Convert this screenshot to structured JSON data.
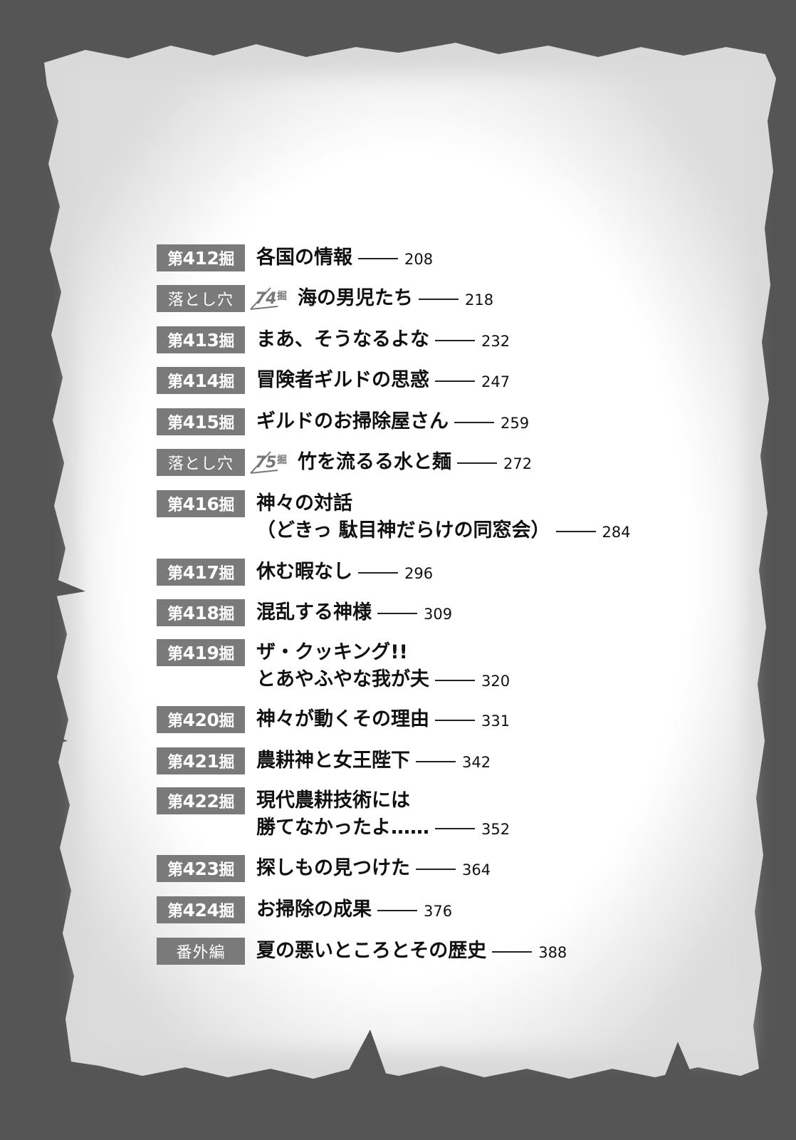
{
  "entries": [
    {
      "type": "chapter",
      "prefix": "第",
      "num": "412",
      "suffix": "掘",
      "lines": [
        "各国の情報"
      ],
      "page": "208"
    },
    {
      "type": "side",
      "label": "落とし穴",
      "sub_num": "74",
      "sub_suffix": "掘",
      "lines": [
        "海の男児たち"
      ],
      "page": "218"
    },
    {
      "type": "chapter",
      "prefix": "第",
      "num": "413",
      "suffix": "掘",
      "lines": [
        "まあ、そうなるよな"
      ],
      "page": "232"
    },
    {
      "type": "chapter",
      "prefix": "第",
      "num": "414",
      "suffix": "掘",
      "lines": [
        "冒険者ギルドの思惑"
      ],
      "page": "247"
    },
    {
      "type": "chapter",
      "prefix": "第",
      "num": "415",
      "suffix": "掘",
      "lines": [
        "ギルドのお掃除屋さん"
      ],
      "page": "259"
    },
    {
      "type": "side",
      "label": "落とし穴",
      "sub_num": "75",
      "sub_suffix": "掘",
      "lines": [
        "竹を流るる水と麺"
      ],
      "page": "272"
    },
    {
      "type": "chapter",
      "prefix": "第",
      "num": "416",
      "suffix": "掘",
      "lines": [
        "神々の対話",
        "（どきっ 駄目神だらけの同窓会）"
      ],
      "page": "284"
    },
    {
      "type": "chapter",
      "prefix": "第",
      "num": "417",
      "suffix": "掘",
      "lines": [
        "休む暇なし"
      ],
      "page": "296"
    },
    {
      "type": "chapter",
      "prefix": "第",
      "num": "418",
      "suffix": "掘",
      "lines": [
        "混乱する神様"
      ],
      "page": "309"
    },
    {
      "type": "chapter",
      "prefix": "第",
      "num": "419",
      "suffix": "掘",
      "lines": [
        "ザ・クッキング!!",
        "とあやふやな我が夫"
      ],
      "page": "320"
    },
    {
      "type": "chapter",
      "prefix": "第",
      "num": "420",
      "suffix": "掘",
      "lines": [
        "神々が動くその理由"
      ],
      "page": "331"
    },
    {
      "type": "chapter",
      "prefix": "第",
      "num": "421",
      "suffix": "掘",
      "lines": [
        "農耕神と女王陛下"
      ],
      "page": "342"
    },
    {
      "type": "chapter",
      "prefix": "第",
      "num": "422",
      "suffix": "掘",
      "lines": [
        "現代農耕技術には",
        "勝てなかったよ……"
      ],
      "page": "352"
    },
    {
      "type": "chapter",
      "prefix": "第",
      "num": "423",
      "suffix": "掘",
      "lines": [
        "探しもの見つけた"
      ],
      "page": "364"
    },
    {
      "type": "chapter",
      "prefix": "第",
      "num": "424",
      "suffix": "掘",
      "lines": [
        "お掃除の成果"
      ],
      "page": "376"
    },
    {
      "type": "extra",
      "label": "番外編",
      "lines": [
        "夏の悪いところとその歴史"
      ],
      "page": "388"
    }
  ]
}
